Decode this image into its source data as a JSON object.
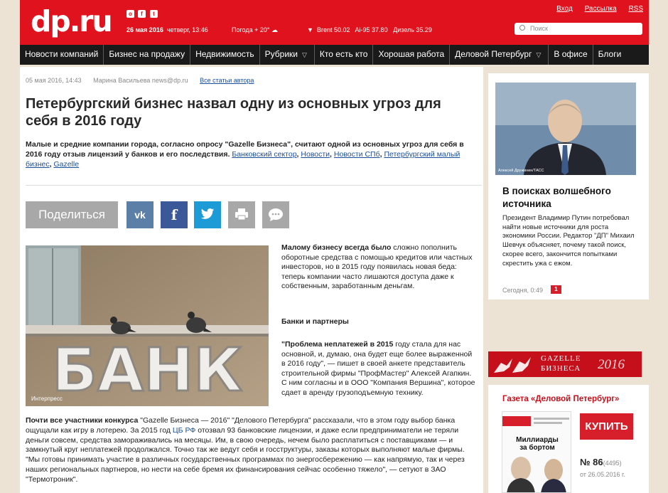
{
  "header": {
    "logo": "dp.ru",
    "date": "26 мая 2016",
    "time": "четверг, 13:46",
    "weather": "Погода + 20°",
    "brent_label": "Brent",
    "brent_value": "50.02",
    "ai95_label": "Ai-95",
    "ai95_value": "37.80",
    "diesel_label": "Дизель",
    "diesel_value": "35.29",
    "links": [
      "Вход",
      "Рассылка",
      "RSS"
    ],
    "search_placeholder": "Поиск"
  },
  "nav": [
    "Новости компаний",
    "Бизнес на продажу",
    "Недвижимость",
    "Рубрики",
    "Кто есть кто",
    "Хорошая работа",
    "Деловой Петербург",
    "В офисе",
    "Блоги"
  ],
  "article": {
    "date": "05 мая 2016, 14:43",
    "author": "Марина Васильева news@dp.ru",
    "all_articles": "Все статьи автора",
    "title": "Петербургский бизнес назвал одну из основных угроз для себя в 2016 году",
    "lead": "Малые и средние компании города, согласно опросу \"Gazelle Бизнеса\", считают одной из основных угроз для себя в 2016 году отзыв лицензий у банков и его последствия.",
    "tags": [
      "Банковский сектор",
      "Новости",
      "Новости СПб",
      "Петербургский малый бизнес",
      "Gazelle"
    ],
    "share_label": "Поделиться",
    "photo_word": "БАНК",
    "photo_credit": "Интерпресс",
    "p1_bold": "Малому бизнесу всегда было",
    "p1": " сложно пополнить оборотные средства с помощью кредитов или частных инвесторов, но в 2015 году появилась новая беда: теперь компании часто лишаются доступа даже к собственным, заработанным деньгам.",
    "subheading": "Банки и партнеры",
    "p2_bold": "\"Проблема неплатежей в 2015",
    "p2": " году стала для нас основной, и, думаю, она будет еще более выраженной в 2016 году\", — пишет в своей анкете представитель строительной фирмы \"ПрофМастер\" Алексей Агапкин. С ним согласны и в ООО \"Компания Вершина\", которое сдает в аренду грузоподъемную технику.",
    "p3_bold": "Почти все участники конкурса",
    "p3_a": " \"Gazelle Бизнеса — 2016\" \"Делового Петербурга\" рассказали, что в этом году выбор банка ощущали как игру в лотерею. За 2015 год ",
    "p3_link": "ЦБ РФ",
    "p3_b": " отозвал 93 банковские лицензии, и даже если предприниматели не теряли деньги совсем, средства замораживались на месяцы. Им, в свою очередь, нечем было расплатиться с поставщиками — и замкнутый круг неплатежей продолжался. Точно так же ведут себя и госструктуры, заказы которых выполняют малые фирмы. \"Мы готовы принимать участие в различных государственных программах по энергосбережению — как напрямую, так и через наших региональных партнеров, но нести на себе бремя их финансирования сейчас особенно тяжело\", — сетуют в ЗАО \"Термотроник\"."
  },
  "sidebar": {
    "photo_credit": "Алексей Дружинин/ТАСС",
    "title": "В поисках волшебного источника",
    "text": "Президент Владимир Путин потребовал найти новые источники для роста экономики России. Редактор \"ДП\" Михаил Шевчук объясняет, почему такой поиск, скорее всего, закончится попытками скрестить ужа с ежом.",
    "date": "Сегодня, 0:49",
    "comments": "1",
    "gazelle_line1": "GAZELLE",
    "gazelle_line2": "БИЗНЕСА",
    "gazelle_year": "2016",
    "paper_title": "Газета «Деловой Петербург»",
    "buy_label": "КУПИТЬ",
    "issue": "№ 86",
    "issue_total": "(4495)",
    "issue_date": "от 26.05.2016 г.",
    "cover_headline": "Миллиарды за бортом"
  },
  "colors": {
    "brand_red": "#e0121d",
    "nav_bg": "#1a1a1a",
    "link": "#1a4f9c"
  }
}
